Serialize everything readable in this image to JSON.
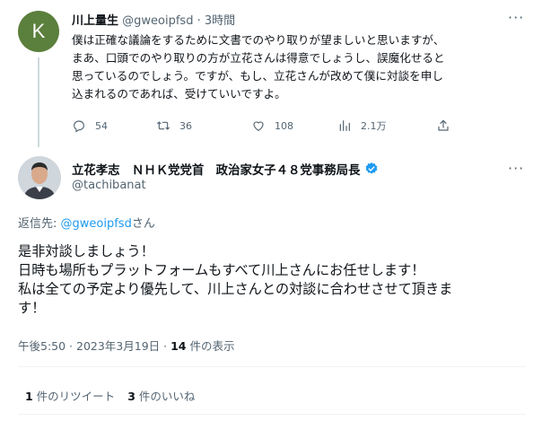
{
  "tweet1": {
    "avatar_letter": "K",
    "display_name": "川上量生",
    "handle": "@gweoipfsd",
    "separator": "·",
    "time_ago": "3時間",
    "text_lines": [
      "僕は正確な議論をするために文書でのやり取りが望ましいと思いますが、",
      "まあ、口頭でのやり取りの方が立花さんは得意でしょうし、誤魔化せると",
      "思っているのでしょう。ですが、もし、立花さんが改めて僕に対談を申し",
      "込まれるのであれば、受けていいですよ。"
    ],
    "stats": {
      "replies": "54",
      "retweets": "36",
      "likes": "108",
      "views": "2.1万"
    }
  },
  "main_tweet": {
    "display_name": "立花孝志　ＮＨＫ党党首　政治家女子４８党事務局長",
    "handle": "@tachibanat",
    "reply_to_prefix": "返信先: ",
    "reply_to_handle": "@gweoipfsd",
    "reply_to_suffix": "さん",
    "text_lines": [
      "是非対談しましょう！",
      "日時も場所もプラットフォームもすべて川上さんにお任せします！",
      "私は全ての予定より優先して、川上さんとの対談に合わせさせて頂きま",
      "す！"
    ],
    "timestamp": "午後5:50 · 2023年3月19日 · ",
    "views_count": "14",
    "views_label": " 件の表示",
    "retweet_count": "1",
    "retweet_label": " 件のリツイート",
    "like_count": "3",
    "like_label": " 件のいいね"
  },
  "colors": {
    "accent": "#1d9bf0",
    "muted": "#536471",
    "text": "#0f1419",
    "avatar_k": "#5b7f3c"
  },
  "icons": [
    "more-icon",
    "reply-icon",
    "retweet-icon",
    "like-icon",
    "views-icon",
    "share-icon",
    "verified-badge-icon"
  ]
}
